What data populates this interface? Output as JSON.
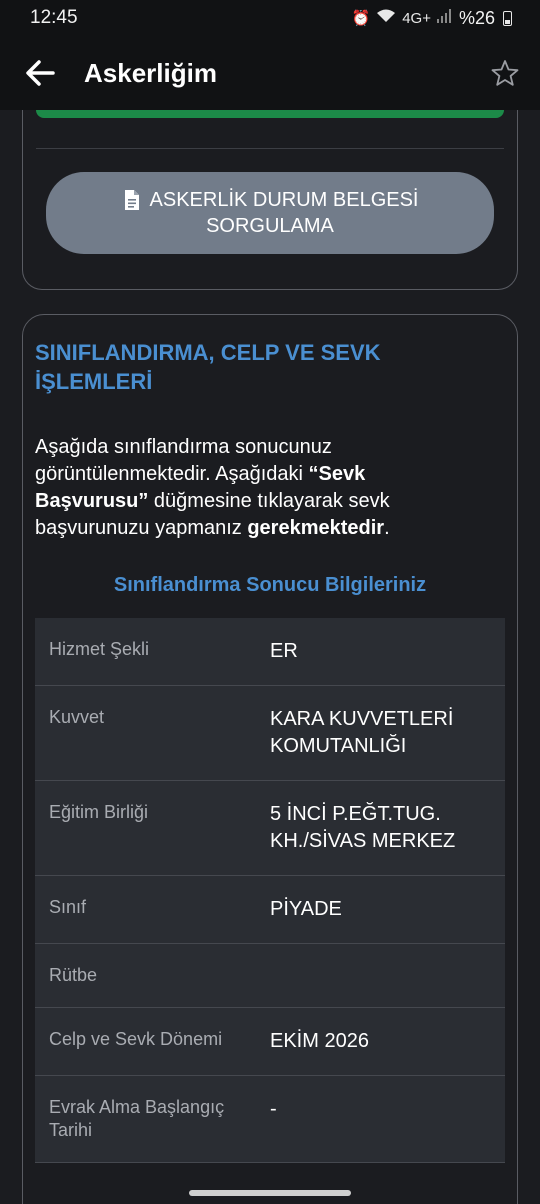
{
  "status": {
    "time": "12:45",
    "network": "4G+",
    "battery": "%26"
  },
  "header": {
    "title": "Askerliğim"
  },
  "query_button": {
    "line1": "ASKERLİK DURUM BELGESİ",
    "line2": "SORGULAMA"
  },
  "section": {
    "title": "SINIFLANDIRMA, CELP VE SEVK İŞLEMLERİ",
    "desc_part1": "Aşağıda sınıflandırma sonucunuz görüntülenmektedir. Aşağıdaki ",
    "desc_bold1": "“Sevk Başvurusu”",
    "desc_part2": " düğmesine tıklayarak sevk başvurunuzu yapmanız ",
    "desc_bold2": "gerekmektedir",
    "desc_part3": ".",
    "subtitle": "Sınıflandırma Sonucu Bilgileriniz"
  },
  "table": {
    "rows": [
      {
        "label": "Hizmet Şekli",
        "value": "ER"
      },
      {
        "label": "Kuvvet",
        "value": "KARA KUVVETLERİ KOMUTANLIĞI"
      },
      {
        "label": "Eğitim Birliği",
        "value": "5 İNCİ P.EĞT.TUG. KH./SİVAS MERKEZ"
      },
      {
        "label": "Sınıf",
        "value": "PİYADE"
      },
      {
        "label": "Rütbe",
        "value": ""
      },
      {
        "label": "Celp ve Sevk Dönemi",
        "value": "EKİM 2026"
      },
      {
        "label": "Evrak Alma Başlangıç Tarihi",
        "value": "-"
      }
    ]
  },
  "colors": {
    "accent": "#4a8fd1",
    "button": "#727c8a",
    "success": "#1c8a48",
    "background": "#1b1c20"
  }
}
